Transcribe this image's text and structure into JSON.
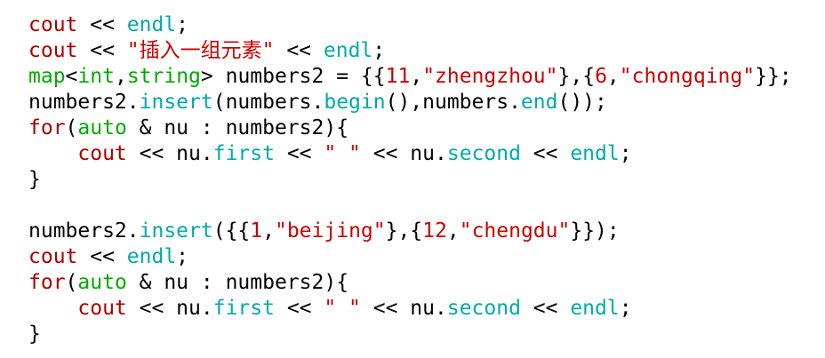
{
  "editor": {
    "lines": [
      [
        {
          "t": "cout",
          "c": "keyword"
        },
        {
          "t": " << ",
          "c": "plain"
        },
        {
          "t": "endl",
          "c": "builtin"
        },
        {
          "t": ";",
          "c": "plain"
        }
      ],
      [
        {
          "t": "cout",
          "c": "keyword"
        },
        {
          "t": " << ",
          "c": "plain"
        },
        {
          "t": "\"插入一组元素\"",
          "c": "string"
        },
        {
          "t": " << ",
          "c": "plain"
        },
        {
          "t": "endl",
          "c": "builtin"
        },
        {
          "t": ";",
          "c": "plain"
        }
      ],
      [
        {
          "t": "map",
          "c": "type"
        },
        {
          "t": "<",
          "c": "plain"
        },
        {
          "t": "int",
          "c": "type"
        },
        {
          "t": ",",
          "c": "plain"
        },
        {
          "t": "string",
          "c": "type"
        },
        {
          "t": "> numbers2 = {{",
          "c": "plain"
        },
        {
          "t": "11",
          "c": "string"
        },
        {
          "t": ",",
          "c": "plain"
        },
        {
          "t": "\"zhengzhou\"",
          "c": "string"
        },
        {
          "t": "},{",
          "c": "plain"
        },
        {
          "t": "6",
          "c": "string"
        },
        {
          "t": ",",
          "c": "plain"
        },
        {
          "t": "\"chongqing\"",
          "c": "string"
        },
        {
          "t": "}};",
          "c": "plain"
        }
      ],
      [
        {
          "t": "numbers2.",
          "c": "plain"
        },
        {
          "t": "insert",
          "c": "builtin"
        },
        {
          "t": "(numbers.",
          "c": "plain"
        },
        {
          "t": "begin",
          "c": "builtin"
        },
        {
          "t": "(),numbers.",
          "c": "plain"
        },
        {
          "t": "end",
          "c": "builtin"
        },
        {
          "t": "());",
          "c": "plain"
        }
      ],
      [
        {
          "t": "for",
          "c": "keyword"
        },
        {
          "t": "(",
          "c": "plain"
        },
        {
          "t": "auto",
          "c": "type"
        },
        {
          "t": " & nu : numbers2){",
          "c": "plain"
        }
      ],
      [
        {
          "t": "    ",
          "c": "plain"
        },
        {
          "t": "cout",
          "c": "keyword"
        },
        {
          "t": " << nu.",
          "c": "plain"
        },
        {
          "t": "first",
          "c": "builtin"
        },
        {
          "t": " << ",
          "c": "plain"
        },
        {
          "t": "\" \"",
          "c": "string"
        },
        {
          "t": " << nu.",
          "c": "plain"
        },
        {
          "t": "second",
          "c": "builtin"
        },
        {
          "t": " << ",
          "c": "plain"
        },
        {
          "t": "endl",
          "c": "builtin"
        },
        {
          "t": ";",
          "c": "plain"
        }
      ],
      [
        {
          "t": "}",
          "c": "plain"
        }
      ],
      [],
      [
        {
          "t": "numbers2.",
          "c": "plain"
        },
        {
          "t": "insert",
          "c": "builtin"
        },
        {
          "t": "({{",
          "c": "plain"
        },
        {
          "t": "1",
          "c": "string"
        },
        {
          "t": ",",
          "c": "plain"
        },
        {
          "t": "\"beijing\"",
          "c": "string"
        },
        {
          "t": "},{",
          "c": "plain"
        },
        {
          "t": "12",
          "c": "string"
        },
        {
          "t": ",",
          "c": "plain"
        },
        {
          "t": "\"chengdu\"",
          "c": "string"
        },
        {
          "t": "}});",
          "c": "plain"
        }
      ],
      [
        {
          "t": "cout",
          "c": "keyword"
        },
        {
          "t": " << ",
          "c": "plain"
        },
        {
          "t": "endl",
          "c": "builtin"
        },
        {
          "t": ";",
          "c": "plain"
        }
      ],
      [
        {
          "t": "for",
          "c": "keyword"
        },
        {
          "t": "(",
          "c": "plain"
        },
        {
          "t": "auto",
          "c": "type"
        },
        {
          "t": " & nu : numbers2){",
          "c": "plain"
        }
      ],
      [
        {
          "t": "    ",
          "c": "plain"
        },
        {
          "t": "cout",
          "c": "keyword"
        },
        {
          "t": " << nu.",
          "c": "plain"
        },
        {
          "t": "first",
          "c": "builtin"
        },
        {
          "t": " << ",
          "c": "plain"
        },
        {
          "t": "\" \"",
          "c": "string"
        },
        {
          "t": " << nu.",
          "c": "plain"
        },
        {
          "t": "second",
          "c": "builtin"
        },
        {
          "t": " << ",
          "c": "plain"
        },
        {
          "t": "endl",
          "c": "builtin"
        },
        {
          "t": ";",
          "c": "plain"
        }
      ],
      [
        {
          "t": "}",
          "c": "plain"
        }
      ]
    ]
  },
  "colors": {
    "background": "#ffffff",
    "keyword": "#aa0000",
    "builtin": "#00aaaa",
    "type": "#00aa00",
    "string": "#cc0000",
    "plain": "#000000"
  }
}
